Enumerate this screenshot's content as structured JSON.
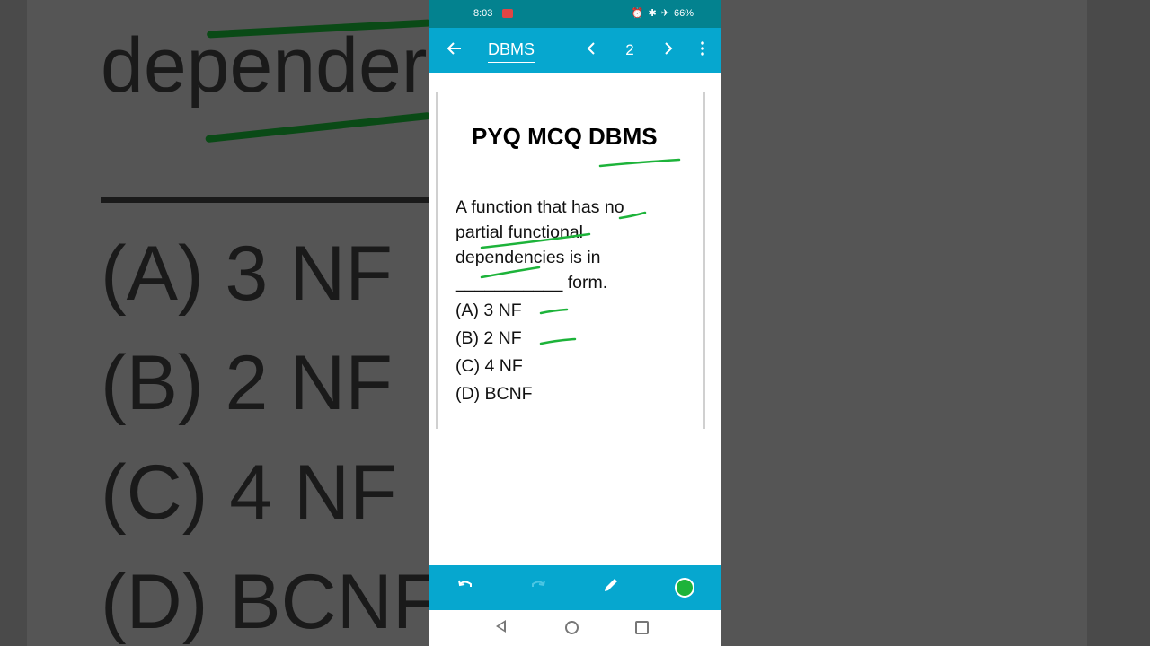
{
  "status_bar": {
    "time": "8:03",
    "battery": "66%"
  },
  "app_bar": {
    "title": "DBMS",
    "page": "2"
  },
  "document": {
    "heading": "PYQ MCQ DBMS",
    "question_lines": [
      "A function that has no",
      "partial functional",
      "dependencies is in",
      "___________ form."
    ],
    "options": [
      "(A) 3 NF",
      "(B) 2 NF",
      "(C) 4 NF",
      "(D) BCNF"
    ]
  },
  "background": {
    "word": "depender",
    "options": [
      "(A) 3 NF",
      "(B) 2 NF",
      "(C) 4 NF",
      "(D) BCNF"
    ]
  },
  "colors": {
    "status_bar": "#03828f",
    "toolbar": "#06a7cf",
    "ink": "#1db33a",
    "selected_color": "#1db33a"
  }
}
